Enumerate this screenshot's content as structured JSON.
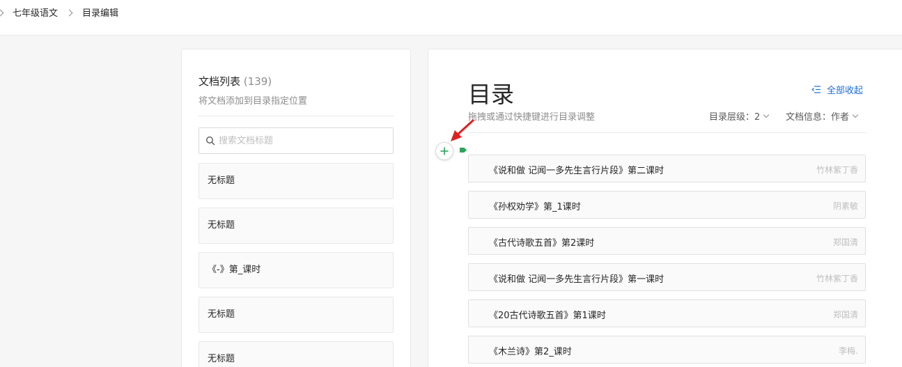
{
  "breadcrumb": {
    "items": [
      "七年级语文",
      "目录编辑"
    ]
  },
  "doc_list": {
    "title": "文档列表",
    "count": "(139)",
    "subtitle": "将文档添加到目录指定位置",
    "search_placeholder": "搜索文档标题",
    "items": [
      "无标题",
      "无标题",
      "《-》第_课时",
      "无标题",
      "无标题"
    ]
  },
  "toc": {
    "title": "目录",
    "collapse_all": "全部收起",
    "hint": "拖拽或通过快捷键进行目录调整",
    "level_label": "目录层级：2",
    "info_label": "文档信息：作者",
    "add_icon": "plus-icon",
    "items": [
      {
        "title": "《说和做 记闻一多先生言行片段》第二课时",
        "author": "竹林紫丁香"
      },
      {
        "title": "《孙权劝学》第_1课时",
        "author": "阴素敏"
      },
      {
        "title": "《古代诗歌五首》第2课时",
        "author": "郑国清"
      },
      {
        "title": "《说和做 记闻一多先生言行片段》第一课时",
        "author": "竹林紫丁香"
      },
      {
        "title": "《20古代诗歌五首》第1课时",
        "author": "郑国清"
      },
      {
        "title": "《木兰诗》第2_课时",
        "author": "李梅."
      }
    ]
  },
  "colors": {
    "accent": "#1d6fd8",
    "green": "#2ea35a",
    "annotation_arrow": "#e02020"
  }
}
